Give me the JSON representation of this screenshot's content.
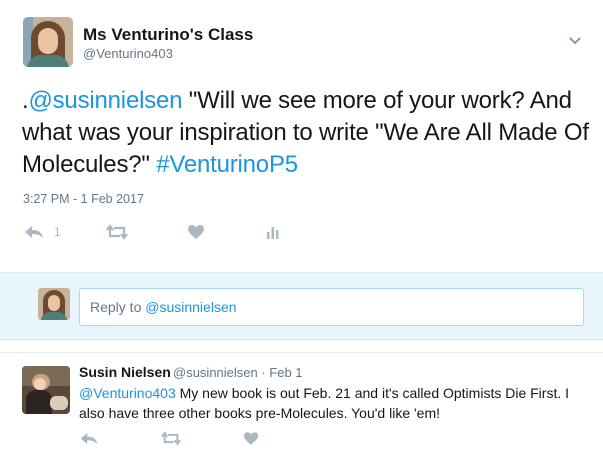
{
  "tweet": {
    "author_name": "Ms Venturino's Class",
    "author_handle": "@Venturino403",
    "text_prefix": ".",
    "mention": "@susinnielsen",
    "text_body": " \"Will we see more of your work? And what was your inspiration to write \"We Are All Made Of Molecules?\" ",
    "hashtag": "#VenturinoP5",
    "timestamp": "3:27 PM - 1 Feb 2017",
    "actions": {
      "reply_icon": "reply-icon",
      "reply_count": "1",
      "retweet_icon": "retweet-icon",
      "like_icon": "heart-icon",
      "analytics_icon": "analytics-icon"
    }
  },
  "reply_composer": {
    "prefix": "Reply to ",
    "mention": "@susinnielsen"
  },
  "reply": {
    "author_name": "Susin Nielsen",
    "meta": "@susinnielsen · Feb 1",
    "mention": "@Venturino403",
    "text": " My new book is out Feb. 21 and it's called Optimists Die First. I also have three other books pre-Molecules. You'd like 'em!",
    "actions": {
      "reply_icon": "reply-icon",
      "retweet_icon": "retweet-icon",
      "like_icon": "heart-icon"
    }
  },
  "colors": {
    "link": "#1b95e0",
    "muted": "#657786",
    "icon": "#aab8c2",
    "reply_band": "#e8f5fd"
  }
}
